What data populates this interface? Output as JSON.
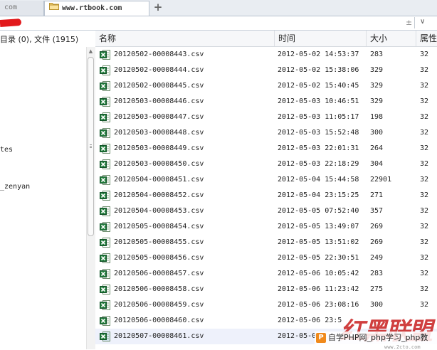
{
  "tabs": {
    "prev_label": "com",
    "active_label": "www.rtbook.com",
    "new_tab_symbol": "+"
  },
  "address": {
    "close_symbol": "±",
    "dropdown_symbol": "∨"
  },
  "left_pane": {
    "status": "目录 (0), 文件 (1915)",
    "labels": [
      "tes",
      "_zenyan"
    ]
  },
  "columns": {
    "name": "名称",
    "time": "时间",
    "size": "大小",
    "attr": "属性"
  },
  "files": [
    {
      "name": "20120502-00008443.csv",
      "time": "2012-05-02 14:53:37",
      "size": "283",
      "attr": "32"
    },
    {
      "name": "20120502-00008444.csv",
      "time": "2012-05-02 15:38:06",
      "size": "329",
      "attr": "32"
    },
    {
      "name": "20120502-00008445.csv",
      "time": "2012-05-02 15:40:45",
      "size": "329",
      "attr": "32"
    },
    {
      "name": "20120503-00008446.csv",
      "time": "2012-05-03 10:46:51",
      "size": "329",
      "attr": "32"
    },
    {
      "name": "20120503-00008447.csv",
      "time": "2012-05-03 11:05:17",
      "size": "198",
      "attr": "32"
    },
    {
      "name": "20120503-00008448.csv",
      "time": "2012-05-03 15:52:48",
      "size": "300",
      "attr": "32"
    },
    {
      "name": "20120503-00008449.csv",
      "time": "2012-05-03 22:01:31",
      "size": "264",
      "attr": "32"
    },
    {
      "name": "20120503-00008450.csv",
      "time": "2012-05-03 22:18:29",
      "size": "304",
      "attr": "32"
    },
    {
      "name": "20120504-00008451.csv",
      "time": "2012-05-04 15:44:58",
      "size": "22901",
      "attr": "32"
    },
    {
      "name": "20120504-00008452.csv",
      "time": "2012-05-04 23:15:25",
      "size": "271",
      "attr": "32"
    },
    {
      "name": "20120504-00008453.csv",
      "time": "2012-05-05 07:52:40",
      "size": "357",
      "attr": "32"
    },
    {
      "name": "20120505-00008454.csv",
      "time": "2012-05-05 13:49:07",
      "size": "269",
      "attr": "32"
    },
    {
      "name": "20120505-00008455.csv",
      "time": "2012-05-05 13:51:02",
      "size": "269",
      "attr": "32"
    },
    {
      "name": "20120505-00008456.csv",
      "time": "2012-05-05 22:30:51",
      "size": "249",
      "attr": "32"
    },
    {
      "name": "20120506-00008457.csv",
      "time": "2012-05-06 10:05:42",
      "size": "283",
      "attr": "32"
    },
    {
      "name": "20120506-00008458.csv",
      "time": "2012-05-06 11:23:42",
      "size": "275",
      "attr": "32"
    },
    {
      "name": "20120506-00008459.csv",
      "time": "2012-05-06 23:08:16",
      "size": "300",
      "attr": "32"
    },
    {
      "name": "20120506-00008460.csv",
      "time": "2012-05-06 23:5",
      "size": "",
      "attr": ""
    },
    {
      "name": "20120507-00008461.csv",
      "time": "2012-05-0",
      "size": "",
      "attr": ""
    }
  ],
  "watermark": {
    "brand": "红黑联盟",
    "bar_logo": "P",
    "bar_text": "自学PHP网_php学习_php教",
    "url": "www.2cto.com"
  },
  "colors": {
    "excel_green": "#1f7a3a",
    "accent_red": "#c81e1e",
    "selected_row": "#eef1fb"
  }
}
